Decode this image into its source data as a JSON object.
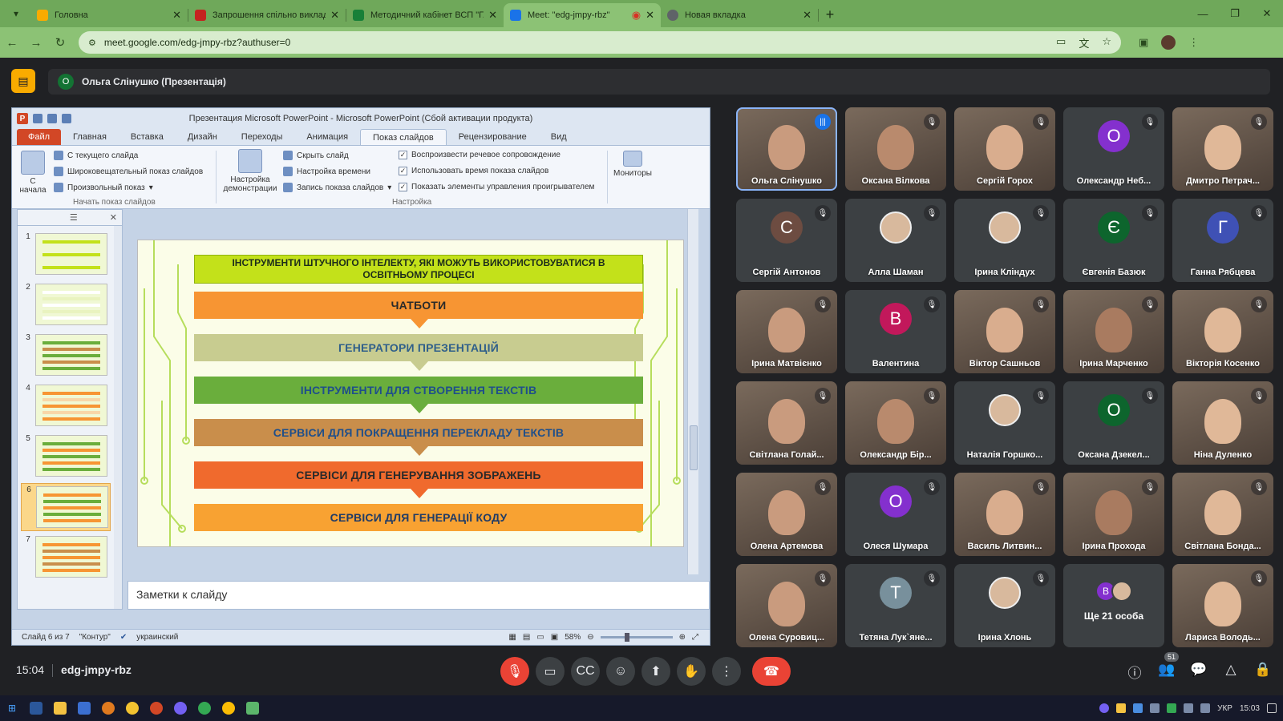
{
  "browser": {
    "tabs": [
      {
        "title": "Головна",
        "color": "#f9ab00"
      },
      {
        "title": "Запрошення спільно виклада...",
        "color": "#c5221f"
      },
      {
        "title": "Методичний кабінет ВСП \"ГА...",
        "color": "#188038"
      },
      {
        "title": "Meet: \"edg-jmpy-rbz\"",
        "color": "#1a73e8"
      },
      {
        "title": "Новая вкладка",
        "color": "#5f6368"
      }
    ],
    "url": "meet.google.com/edg-jmpy-rbz?authuser=0"
  },
  "meet": {
    "presenter_initial": "О",
    "presenter_label": "Ольга Слінушко (Презентація)",
    "time": "15:04",
    "meeting_code": "edg-jmpy-rbz",
    "people_count": "51",
    "participants": [
      {
        "name": "Ольга Слінушко",
        "kind": "video",
        "speaking": true
      },
      {
        "name": "Оксана Вілкова",
        "kind": "video"
      },
      {
        "name": "Сергій Горох",
        "kind": "video"
      },
      {
        "name": "Олександр Неб...",
        "kind": "letter",
        "letter": "О",
        "color": "#8430ce"
      },
      {
        "name": "Дмитро Петрач...",
        "kind": "video"
      },
      {
        "name": "Сергій Антонов",
        "kind": "letter",
        "letter": "С",
        "color": "#6d4c41"
      },
      {
        "name": "Алла Шаман",
        "kind": "photo"
      },
      {
        "name": "Ірина Кліндух",
        "kind": "photo"
      },
      {
        "name": "Євгенія Базюк",
        "kind": "letter",
        "letter": "Є",
        "color": "#0d652d"
      },
      {
        "name": "Ганна Рябцева",
        "kind": "letter",
        "letter": "Г",
        "color": "#3f51b5"
      },
      {
        "name": "Ірина Матвієнко",
        "kind": "video"
      },
      {
        "name": "Валентина",
        "kind": "letter",
        "letter": "В",
        "color": "#c2185b"
      },
      {
        "name": "Віктор Сашньов",
        "kind": "video"
      },
      {
        "name": "Ірина Марченко",
        "kind": "video"
      },
      {
        "name": "Вікторія Косенко",
        "kind": "video"
      },
      {
        "name": "Світлана Голай...",
        "kind": "video"
      },
      {
        "name": "Олександр Бір...",
        "kind": "video"
      },
      {
        "name": "Наталія Горшко...",
        "kind": "photo"
      },
      {
        "name": "Оксана Дзекел...",
        "kind": "letter",
        "letter": "О",
        "color": "#0d652d"
      },
      {
        "name": "Ніна Дуленко",
        "kind": "video"
      },
      {
        "name": "Олена Артемова",
        "kind": "video"
      },
      {
        "name": "Олеся Шумара",
        "kind": "letter",
        "letter": "О",
        "color": "#8430ce"
      },
      {
        "name": "Василь Литвин...",
        "kind": "video"
      },
      {
        "name": "Ірина Прохода",
        "kind": "video"
      },
      {
        "name": "Світлана Бонда...",
        "kind": "video"
      },
      {
        "name": "Олена Суровиц...",
        "kind": "video"
      },
      {
        "name": "Тетяна Лук`яне...",
        "kind": "letter",
        "letter": "Т",
        "color": "#78909c"
      },
      {
        "name": "Ірина Хлонь",
        "kind": "photo"
      },
      {
        "name": "Ще 21 особа",
        "kind": "more",
        "letter": "В",
        "color": "#8430ce"
      },
      {
        "name": "Лариса Володь...",
        "kind": "video"
      }
    ]
  },
  "ppt": {
    "window_title": "Презентация Microsoft PowerPoint - Microsoft PowerPoint (Сбой активации продукта)",
    "ribbon_tabs": [
      "Файл",
      "Главная",
      "Вставка",
      "Дизайн",
      "Переходы",
      "Анимация",
      "Показ слайдов",
      "Рецензирование",
      "Вид"
    ],
    "ribbon": {
      "from_start": "С начала",
      "from_current": "С текущего слайда",
      "broadcast": "Широковещательный показ слайдов",
      "custom_show": "Произвольный показ",
      "group1": "Начать показ слайдов",
      "setup_show": "Настройка демонстрации",
      "hide_slide": "Скрыть слайд",
      "rehearse": "Настройка времени",
      "record": "Запись показа слайдов",
      "play_narration": "Воспроизвести речевое сопровождение",
      "use_timings": "Использовать время показа слайдов",
      "show_controls": "Показать элементы управления проигрывателем",
      "group2": "Настройка",
      "monitors": "Мониторы"
    },
    "slide_numbers": [
      "1",
      "2",
      "3",
      "4",
      "5",
      "6",
      "7"
    ],
    "selected_slide": 6,
    "slide": {
      "title": "ІНСТРУМЕНТИ ШТУЧНОГО ІНТЕЛЕКТУ, ЯКІ МОЖУТЬ ВИКОРИСТОВУВАТИСЯ В ОСВІТНЬОМУ ПРОЦЕСІ",
      "items": [
        {
          "text": "ЧАТБОТИ",
          "bg": "#f79533",
          "fg": "#2a2a2a"
        },
        {
          "text": "ГЕНЕРАТОРИ ПРЕЗЕНТАЦІЙ",
          "bg": "#c8cc90",
          "fg": "#2f5f8a"
        },
        {
          "text": "ІНСТРУМЕНТИ ДЛЯ СТВОРЕННЯ ТЕКСТІВ",
          "bg": "#6aae3c",
          "fg": "#1f4f8a"
        },
        {
          "text": "СЕРВІСИ ДЛЯ ПОКРАЩЕННЯ ПЕРЕКЛАДУ ТЕКСТІВ",
          "bg": "#c98e4b",
          "fg": "#1f4f8a"
        },
        {
          "text": "СЕРВІСИ ДЛЯ ГЕНЕРУВАННЯ ЗОБРАЖЕНЬ",
          "bg": "#f06a2d",
          "fg": "#2a2a2a"
        },
        {
          "text": "СЕРВІСИ ДЛЯ ГЕНЕРАЦІЇ КОДУ",
          "bg": "#f8a232",
          "fg": "#1f3b66"
        }
      ]
    },
    "notes_placeholder": "Заметки к слайду",
    "status": {
      "slide_info": "Слайд 6 из 7",
      "theme": "\"Контур\"",
      "language": "украинский",
      "zoom": "58%"
    }
  },
  "taskbar": {
    "lang": "УКР",
    "clock": "15:03"
  }
}
